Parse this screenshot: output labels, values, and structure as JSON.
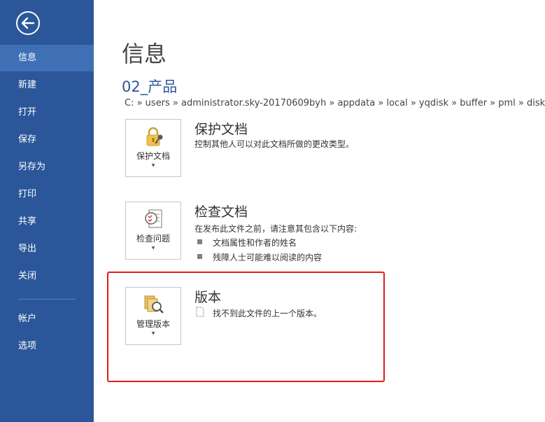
{
  "sidebar": {
    "items": [
      {
        "label": "信息"
      },
      {
        "label": "新建"
      },
      {
        "label": "打开"
      },
      {
        "label": "保存"
      },
      {
        "label": "另存为"
      },
      {
        "label": "打印"
      },
      {
        "label": "共享"
      },
      {
        "label": "导出"
      },
      {
        "label": "关闭"
      },
      {
        "label": "帐户"
      },
      {
        "label": "选项"
      }
    ]
  },
  "main": {
    "title": "信息",
    "doc_name": "02_产品",
    "doc_path": "C: » users » administrator.sky-20170609byh » appdata » local » yqdisk » buffer » pml » diskmap »",
    "sections": {
      "protect": {
        "button_label": "保护文档",
        "title": "保护文档",
        "description": "控制其他人可以对此文档所做的更改类型。"
      },
      "inspect": {
        "button_label": "检查问题",
        "title": "检查文档",
        "description": "在发布此文件之前，请注意其包含以下内容:",
        "bullets": [
          "文档属性和作者的姓名",
          "残障人士可能难以阅读的内容"
        ]
      },
      "versions": {
        "button_label": "管理版本",
        "title": "版本",
        "description": "找不到此文件的上一个版本。"
      }
    }
  },
  "colors": {
    "sidebar": "#2b579a",
    "active": "#3f6fb5",
    "accent_text": "#2b579a",
    "highlight_border": "#e41b17"
  }
}
